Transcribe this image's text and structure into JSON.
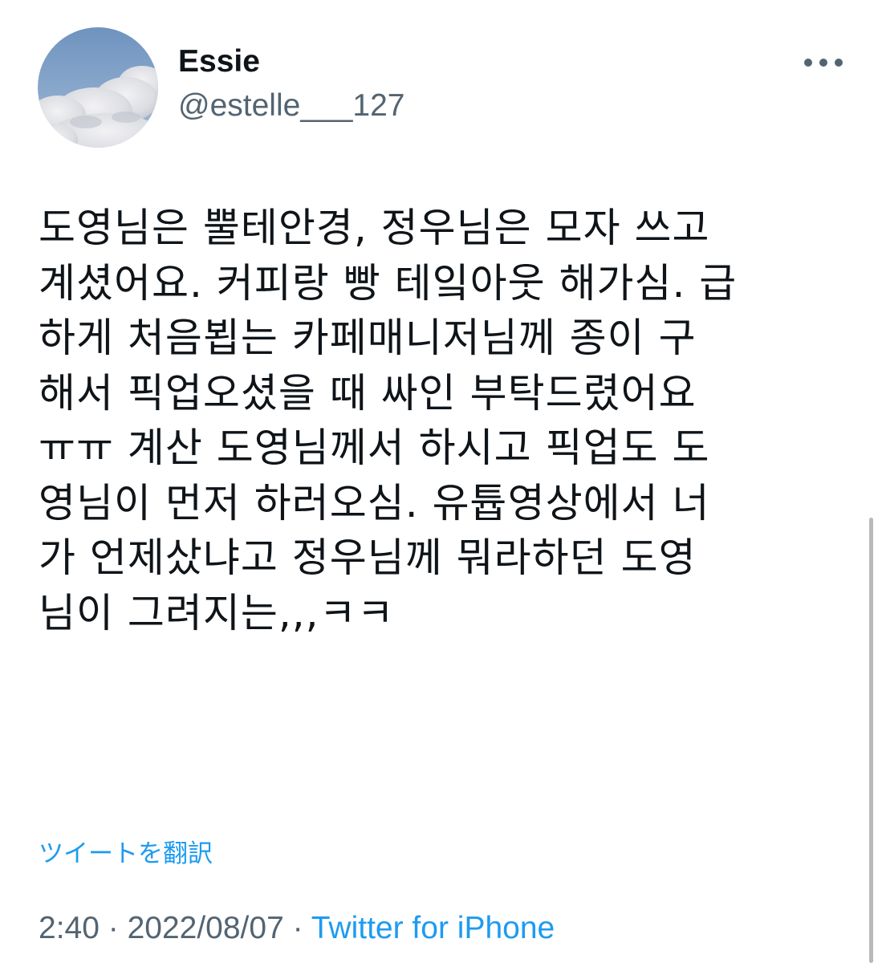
{
  "user": {
    "display_name": "Essie",
    "handle": "@estelle___127",
    "avatar_icon": "cloud-sky-avatar"
  },
  "tweet": {
    "lines": [
      "도영님은 뿔테안경, 정우님은 모자 쓰고",
      "계셨어요. 커피랑 빵 테잌아웃 해가심. 급",
      "하게 처음뵙는 카페매니저님께 종이 구",
      "해서 픽업오셨을 때 싸인 부탁드렸어요",
      "ㅠㅠ 계산 도영님께서 하시고 픽업도 도",
      "영님이 먼저 하러오심. 유튭영상에서 너",
      "가 언제샀냐고 정우님께 뭐라하던 도영",
      "님이 그려지는,,,ㅋㅋ"
    ],
    "translate_label": "ツイートを翻訳",
    "time": "2:40",
    "separator": " · ",
    "date": "2022/08/07",
    "source": "Twitter for iPhone"
  },
  "icons": {
    "more": "more-dots-icon"
  },
  "colors": {
    "text": "#0f1419",
    "secondary": "#536471",
    "accent": "#1d9bf0"
  }
}
